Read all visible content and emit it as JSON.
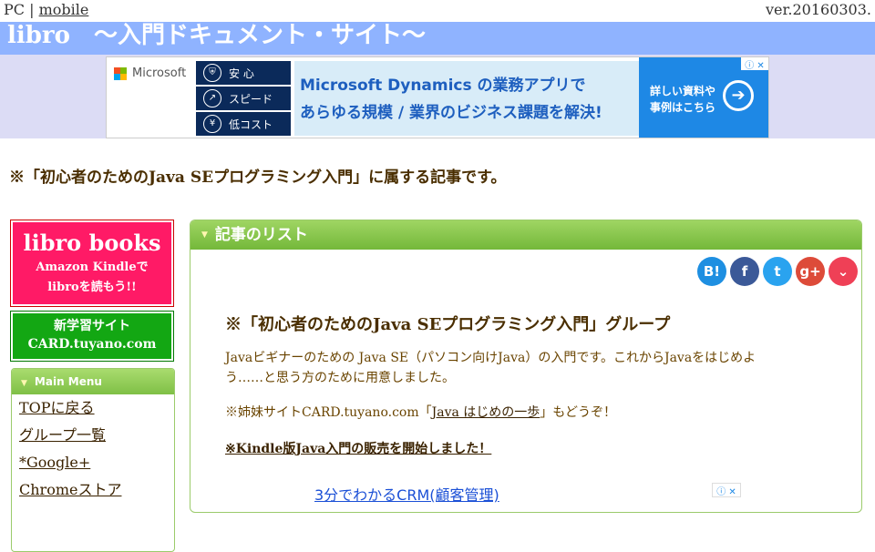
{
  "top": {
    "pc": "PC",
    "sep": "|",
    "mobile": "mobile",
    "version": "ver.20160303."
  },
  "title": "libro　〜入門ドキュメント・サイト〜",
  "ad": {
    "brand": "Microsoft",
    "features": [
      {
        "icon": "shield-icon",
        "label": "安 心"
      },
      {
        "icon": "speed-icon",
        "label": "スピード"
      },
      {
        "icon": "yen-icon",
        "label": "低コスト"
      }
    ],
    "line1": "Microsoft Dynamics の業務アプリで",
    "line2": "あらゆる規模 / 業界のビジネス課題を解決!",
    "cta_line1": "詳しい資料や",
    "cta_line2": "事例はこちら",
    "adchoices": "ⓘ ✕"
  },
  "group_note": "※「初心者のためのJava SEプログラミング入門」に属する記事です。",
  "sidebar": {
    "books_title": "libro books",
    "books_sub1": "Amazon Kindleで",
    "books_sub2": "libroを読もう!!",
    "card_line1": "新学習サイト",
    "card_line2": "CARD.tuyano.com",
    "menu_title": "Main Menu",
    "menu_items": [
      "TOPに戻る",
      "グループ一覧",
      "*Google+",
      "Chromeストア"
    ]
  },
  "main": {
    "header": "記事のリスト",
    "share": [
      {
        "icon": "hatena-bookmark-icon",
        "text": "B!",
        "color": "#1e8fe1"
      },
      {
        "icon": "facebook-icon",
        "text": "f",
        "color": "#3b5998"
      },
      {
        "icon": "twitter-icon",
        "text": "t",
        "color": "#2aa3ef"
      },
      {
        "icon": "google-plus-icon",
        "text": "g+",
        "color": "#dd4b39"
      },
      {
        "icon": "pocket-icon",
        "text": "⌄",
        "color": "#ef4056"
      }
    ],
    "group_title": "※「初心者のためのJava SEプログラミング入門」グループ",
    "desc_line1": "Javaビギナーのための Java SE（パソコン向けJava）の入門です。これからJavaをはじめよ",
    "desc_line2": "う……と思う方のために用意しました。",
    "sister_prefix": "※姉妹サイトCARD.tuyano.com「",
    "sister_link": "Java はじめの一歩",
    "sister_suffix": "」もどうぞ！",
    "kindle_link": "※Kindle版Java入門の販売を開始しました！",
    "ad2_text": "3分でわかるCRM(顧客管理)",
    "ad2_choices": "ⓘ ✕"
  },
  "colors": {
    "title_band": "#8fb3ff",
    "ad_band": "#dcdcf5",
    "green": "#7fc046",
    "pink": "#ff1a66"
  }
}
